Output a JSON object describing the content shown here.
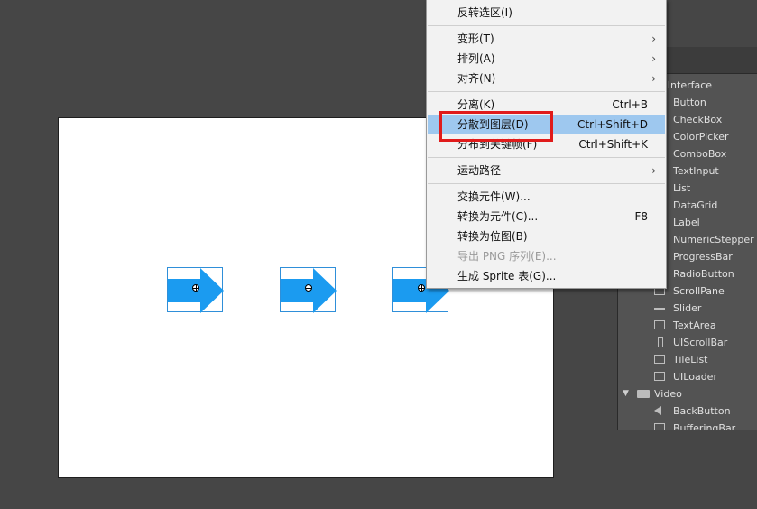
{
  "stage": {
    "symbols": [
      {
        "name": "arrow-symbol-1"
      },
      {
        "name": "arrow-symbol-2"
      },
      {
        "name": "arrow-symbol-3"
      }
    ]
  },
  "components_panel": {
    "items": [
      {
        "label": "er Interface",
        "type": "folder-tail"
      },
      {
        "label": "Button"
      },
      {
        "label": "CheckBox"
      },
      {
        "label": "ColorPicker"
      },
      {
        "label": "ComboBox"
      },
      {
        "label": "TextInput"
      },
      {
        "label": "List"
      },
      {
        "label": "DataGrid"
      },
      {
        "label": "Label"
      },
      {
        "label": "NumericStepper"
      },
      {
        "label": "ProgressBar"
      },
      {
        "label": "RadioButton"
      },
      {
        "label": "ScrollPane"
      },
      {
        "label": "Slider"
      },
      {
        "label": "TextArea"
      },
      {
        "label": "UIScrollBar"
      },
      {
        "label": "TileList"
      },
      {
        "label": "UILoader"
      },
      {
        "label": "Video",
        "type": "folder"
      },
      {
        "label": "BackButton"
      },
      {
        "label": "BufferingBar"
      }
    ]
  },
  "context_menu": {
    "items": [
      {
        "label": "反转选区(I)",
        "shortcut": ""
      },
      {
        "label": "变形(T)",
        "submenu": "›"
      },
      {
        "label": "排列(A)",
        "submenu": "›"
      },
      {
        "label": "对齐(N)",
        "submenu": "›"
      },
      {
        "label": "分离(K)",
        "shortcut": "Ctrl+B"
      },
      {
        "label": "分散到图层(D)",
        "shortcut": "Ctrl+Shift+D",
        "highlighted": true
      },
      {
        "label": "分布到关键帧(F)",
        "shortcut": "Ctrl+Shift+K"
      },
      {
        "label": "运动路径",
        "submenu": "›"
      },
      {
        "label": "交换元件(W)...",
        "shortcut": ""
      },
      {
        "label": "转换为元件(C)...",
        "shortcut": "F8"
      },
      {
        "label": "转换为位图(B)",
        "shortcut": ""
      },
      {
        "label": "导出 PNG 序列(E)...",
        "shortcut": "",
        "disabled": true
      },
      {
        "label": "生成 Sprite 表(G)...",
        "shortcut": ""
      }
    ]
  },
  "colors": {
    "workspace": "#464646",
    "symbol_fill": "#1b9bf0",
    "highlight": "#9ec8ef",
    "callout": "#e01b1b"
  }
}
